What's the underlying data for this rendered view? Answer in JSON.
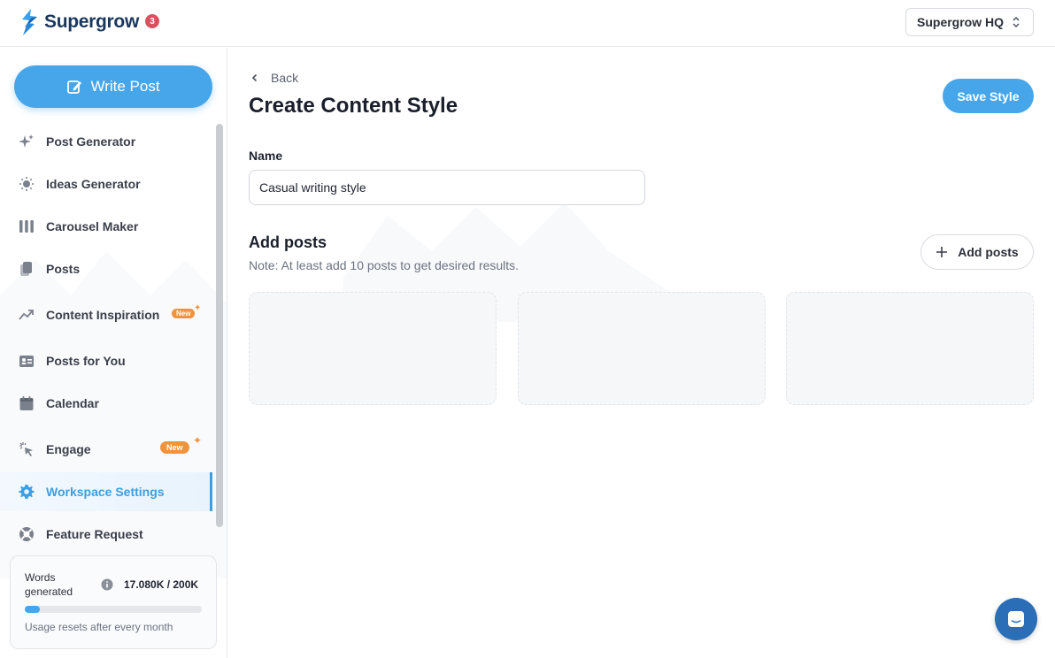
{
  "header": {
    "brand": "Supergrow",
    "notification_count": "3",
    "workspace": "Supergrow HQ"
  },
  "sidebar": {
    "write_post_label": "Write Post",
    "items": [
      {
        "label": "Post Generator",
        "icon": "sparkles-icon"
      },
      {
        "label": "Ideas Generator",
        "icon": "lightbulb-icon"
      },
      {
        "label": "Carousel Maker",
        "icon": "columns-icon"
      },
      {
        "label": "Posts",
        "icon": "documents-icon"
      },
      {
        "label": "Content Inspiration",
        "icon": "trending-icon",
        "badge": "New"
      },
      {
        "label": "Posts for You",
        "icon": "id-card-icon"
      },
      {
        "label": "Calendar",
        "icon": "calendar-icon"
      },
      {
        "label": "Engage",
        "icon": "cursor-click-icon",
        "badge": "New"
      },
      {
        "label": "Workspace Settings",
        "icon": "gear-icon",
        "active": true
      },
      {
        "label": "Feature Request",
        "icon": "lifebuoy-icon"
      }
    ],
    "usage": {
      "label": "Words generated",
      "value": "17.080K / 200K",
      "progress": 0.085,
      "note": "Usage resets after every month"
    }
  },
  "main": {
    "back_label": "Back",
    "title": "Create Content Style",
    "save_label": "Save Style",
    "name_label": "Name",
    "name_value": "Casual writing style",
    "posts_title": "Add posts",
    "posts_note": "Note: At least add 10 posts to get desired results.",
    "add_posts_label": "Add posts",
    "post_slots": 3
  },
  "colors": {
    "accent": "#47a6ea",
    "active_text": "#3b9fe3",
    "badge": "#f0933c",
    "notification": "#d9515f",
    "chat": "#2a6eb8"
  }
}
